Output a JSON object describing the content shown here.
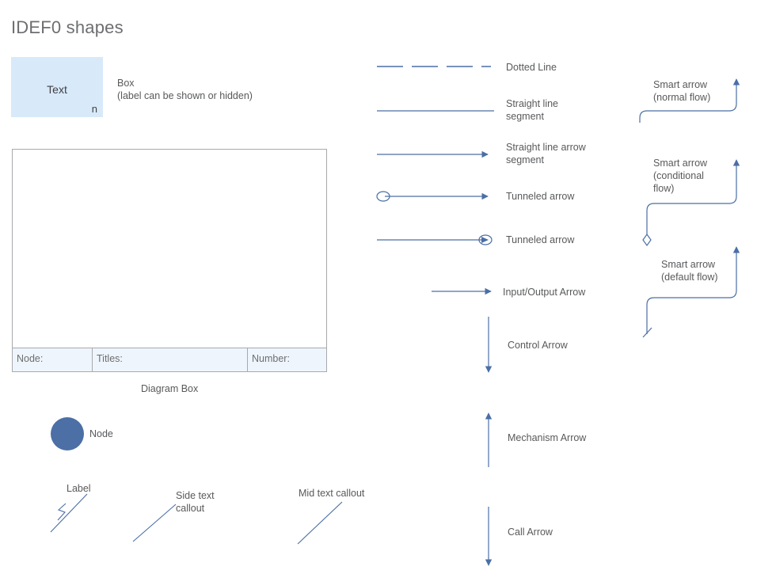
{
  "page": {
    "title": "IDEF0 shapes",
    "background": "#ffffff",
    "text_color": "#58595b",
    "accent_line_color": "#4a6fa5",
    "box_fill_color": "#d8e9f9",
    "node_fill_color": "#4c6fa5",
    "footer_fill_color": "#eef5fc",
    "border_color": "#a9a9ac"
  },
  "box_shape": {
    "text": "Text",
    "number": "n",
    "caption": "Box\n(label can be shown or hidden)"
  },
  "diagram_box": {
    "caption": "Diagram Box",
    "footer_cells": [
      {
        "label": "Node:",
        "value": ""
      },
      {
        "label": "Titles:",
        "value": ""
      },
      {
        "label": "Number:",
        "value": ""
      }
    ]
  },
  "node": {
    "label": "Node"
  },
  "callouts": [
    {
      "name": "label-callout",
      "text": "Label"
    },
    {
      "name": "side-text-callout",
      "text": "Side text\ncallout"
    },
    {
      "name": "mid-text-callout",
      "text": "Mid text callout"
    }
  ],
  "connectors": [
    {
      "name": "dotted-line",
      "label": "Dotted Line"
    },
    {
      "name": "straight-line-segment",
      "label": "Straight line\nsegment"
    },
    {
      "name": "straight-line-arrow-segment",
      "label": "Straight line arrow\nsegment"
    },
    {
      "name": "tunneled-arrow-start",
      "label": "Tunneled arrow"
    },
    {
      "name": "tunneled-arrow-end",
      "label": "Tunneled arrow"
    },
    {
      "name": "input-output-arrow",
      "label": "Input/Output Arrow"
    },
    {
      "name": "control-arrow",
      "label": "Control Arrow"
    },
    {
      "name": "mechanism-arrow",
      "label": "Mechanism Arrow"
    },
    {
      "name": "call-arrow",
      "label": "Call Arrow"
    }
  ],
  "smart_arrows": [
    {
      "name": "smart-arrow-normal",
      "label": "Smart arrow\n(normal flow)"
    },
    {
      "name": "smart-arrow-conditional",
      "label": "Smart arrow\n(conditional\nflow)"
    },
    {
      "name": "smart-arrow-default",
      "label": "Smart arrow\n(default flow)"
    }
  ]
}
